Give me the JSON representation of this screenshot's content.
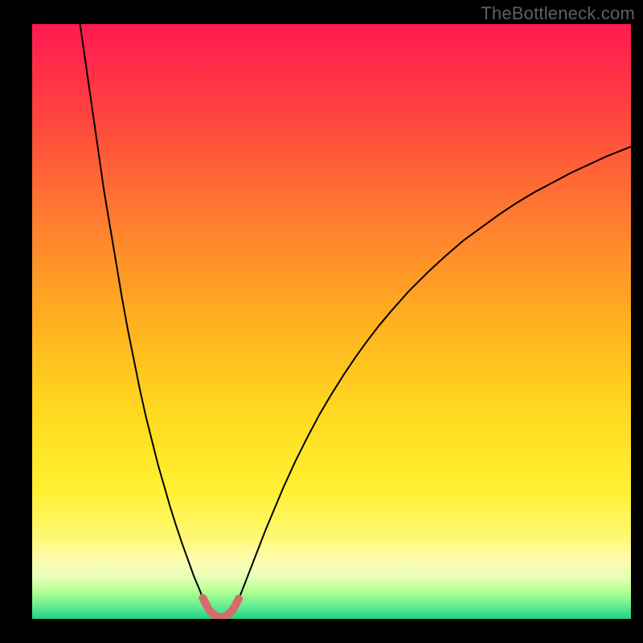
{
  "watermark": "TheBottleneck.com",
  "gradient": {
    "stops": [
      {
        "offset": "0%",
        "color": "#ff1a52"
      },
      {
        "offset": "14%",
        "color": "#ff4040"
      },
      {
        "offset": "32%",
        "color": "#ff7a30"
      },
      {
        "offset": "50%",
        "color": "#ffb020"
      },
      {
        "offset": "65%",
        "color": "#ffd820"
      },
      {
        "offset": "78%",
        "color": "#fff030"
      },
      {
        "offset": "86%",
        "color": "#fff870"
      },
      {
        "offset": "90%",
        "color": "#fffcb0"
      },
      {
        "offset": "93%",
        "color": "#e6ffb8"
      },
      {
        "offset": "95.5%",
        "color": "#b0ff90"
      },
      {
        "offset": "97.5%",
        "color": "#70f090"
      },
      {
        "offset": "99%",
        "color": "#40e090"
      },
      {
        "offset": "100%",
        "color": "#20d080"
      }
    ]
  },
  "chart_data": {
    "type": "line",
    "title": "",
    "xlabel": "",
    "ylabel": "",
    "xlim": [
      0,
      100
    ],
    "ylim": [
      0,
      100
    ],
    "series": [
      {
        "name": "curve",
        "color": "#000000",
        "points": [
          [
            8,
            100
          ],
          [
            9,
            93
          ],
          [
            10,
            86
          ],
          [
            11,
            79
          ],
          [
            12,
            72
          ],
          [
            13,
            66
          ],
          [
            14,
            60
          ],
          [
            15,
            54
          ],
          [
            16,
            48.5
          ],
          [
            17,
            43.5
          ],
          [
            18,
            38.5
          ],
          [
            19,
            34
          ],
          [
            20,
            30
          ],
          [
            21,
            26
          ],
          [
            22,
            22.5
          ],
          [
            23,
            19
          ],
          [
            24,
            15.8
          ],
          [
            25,
            12.8
          ],
          [
            26,
            10
          ],
          [
            27,
            7.2
          ],
          [
            28,
            4.8
          ],
          [
            28.5,
            3.5
          ],
          [
            29,
            2.5
          ],
          [
            29.5,
            1.6
          ],
          [
            30,
            1.0
          ],
          [
            30.5,
            0.6
          ],
          [
            31,
            0.35
          ],
          [
            31.5,
            0.25
          ],
          [
            32,
            0.3
          ],
          [
            32.5,
            0.55
          ],
          [
            33,
            0.95
          ],
          [
            33.5,
            1.55
          ],
          [
            34,
            2.4
          ],
          [
            34.5,
            3.4
          ],
          [
            35,
            4.6
          ],
          [
            36,
            7.2
          ],
          [
            37,
            9.8
          ],
          [
            38,
            12.4
          ],
          [
            39,
            15.0
          ],
          [
            40,
            17.4
          ],
          [
            42,
            22.2
          ],
          [
            44,
            26.6
          ],
          [
            46,
            30.6
          ],
          [
            48,
            34.4
          ],
          [
            50,
            37.8
          ],
          [
            52,
            41.0
          ],
          [
            54,
            44.0
          ],
          [
            56,
            46.8
          ],
          [
            58,
            49.4
          ],
          [
            60,
            51.8
          ],
          [
            63,
            55.2
          ],
          [
            66,
            58.2
          ],
          [
            69,
            61.0
          ],
          [
            72,
            63.6
          ],
          [
            75,
            65.8
          ],
          [
            78,
            68.0
          ],
          [
            81,
            70.0
          ],
          [
            84,
            71.8
          ],
          [
            87,
            73.4
          ],
          [
            90,
            75.0
          ],
          [
            93,
            76.4
          ],
          [
            96,
            77.8
          ],
          [
            99,
            79.0
          ],
          [
            100,
            79.4
          ]
        ]
      },
      {
        "name": "bottom-marker",
        "color": "#d76a6a",
        "width": 10,
        "points": [
          [
            28.5,
            3.5
          ],
          [
            29,
            2.5
          ],
          [
            29.5,
            1.6
          ],
          [
            30,
            1.0
          ],
          [
            30.5,
            0.6
          ],
          [
            31,
            0.35
          ],
          [
            31.5,
            0.25
          ],
          [
            32,
            0.3
          ],
          [
            32.5,
            0.55
          ],
          [
            33,
            0.95
          ],
          [
            33.5,
            1.55
          ],
          [
            34,
            2.4
          ],
          [
            34.5,
            3.4
          ]
        ]
      }
    ]
  }
}
